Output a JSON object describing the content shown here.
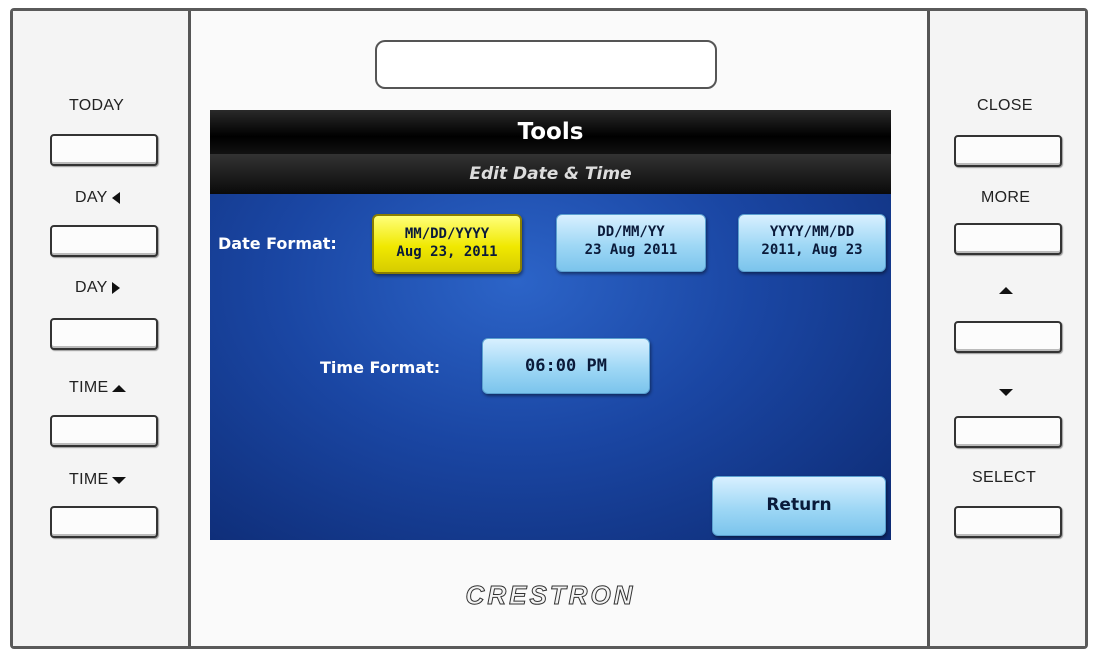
{
  "left_buttons": [
    {
      "label": "TODAY",
      "arrow": ""
    },
    {
      "label": "DAY",
      "arrow": "left"
    },
    {
      "label": "DAY",
      "arrow": "right"
    },
    {
      "label": "TIME",
      "arrow": "up"
    },
    {
      "label": "TIME",
      "arrow": "down"
    }
  ],
  "right_buttons": [
    {
      "label": "CLOSE",
      "arrow": ""
    },
    {
      "label": "MORE",
      "arrow": ""
    },
    {
      "label": "",
      "arrow": "up"
    },
    {
      "label": "",
      "arrow": "down"
    },
    {
      "label": "SELECT",
      "arrow": ""
    }
  ],
  "brand": "CRESTRON",
  "screen": {
    "title": "Tools",
    "subtitle": "Edit Date & Time",
    "date_format_label": "Date Format:",
    "date_formats": [
      {
        "format": "MM/DD/YYYY",
        "example": "Aug 23, 2011",
        "selected": true
      },
      {
        "format": "DD/MM/YY",
        "example": "23 Aug 2011",
        "selected": false
      },
      {
        "format": "YYYY/MM/DD",
        "example": "2011, Aug 23",
        "selected": false
      }
    ],
    "time_format_label": "Time Format:",
    "time_format_value": "06:00 PM",
    "return_label": "Return"
  },
  "colors": {
    "selected_button": "#f0e800",
    "button": "#9ed7f5",
    "screen_background": "#1a46a3",
    "title_bar": "#000000"
  }
}
